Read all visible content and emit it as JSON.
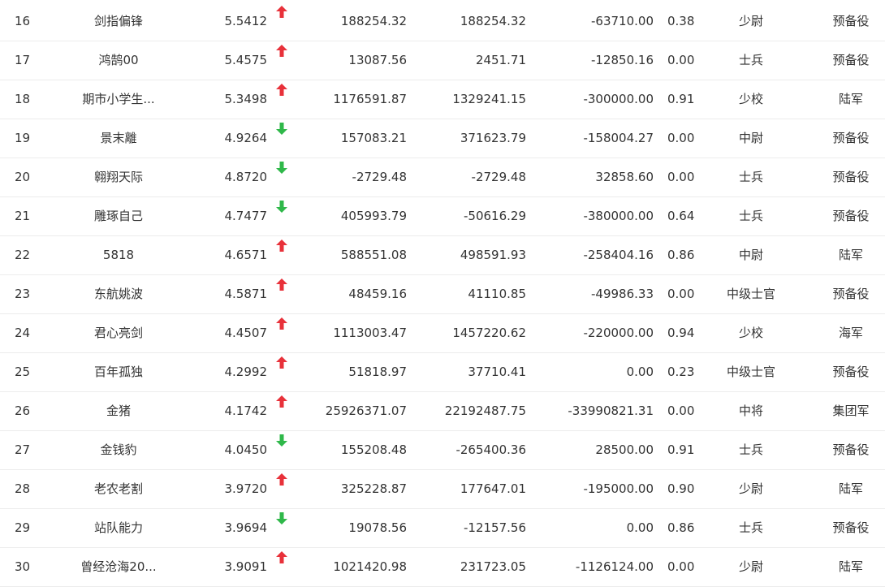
{
  "colors": {
    "up": "#e8313a",
    "down": "#2fb84a",
    "text": "#333333",
    "row_border": "#ececec"
  },
  "rows": [
    {
      "rank": "16",
      "name": "剑指偏锋",
      "score": "5.5412",
      "trend": "up",
      "v1": "188254.32",
      "v2": "188254.32",
      "v3": "-63710.00",
      "ratio": "0.38",
      "rank_title": "少尉",
      "group": "预备役"
    },
    {
      "rank": "17",
      "name": "鸿鹄00",
      "score": "5.4575",
      "trend": "up",
      "v1": "13087.56",
      "v2": "2451.71",
      "v3": "-12850.16",
      "ratio": "0.00",
      "rank_title": "士兵",
      "group": "预备役"
    },
    {
      "rank": "18",
      "name": "期市小学生...",
      "score": "5.3498",
      "trend": "up",
      "v1": "1176591.87",
      "v2": "1329241.15",
      "v3": "-300000.00",
      "ratio": "0.91",
      "rank_title": "少校",
      "group": "陆军"
    },
    {
      "rank": "19",
      "name": "景末離",
      "score": "4.9264",
      "trend": "down",
      "v1": "157083.21",
      "v2": "371623.79",
      "v3": "-158004.27",
      "ratio": "0.00",
      "rank_title": "中尉",
      "group": "预备役"
    },
    {
      "rank": "20",
      "name": "翱翔天际",
      "score": "4.8720",
      "trend": "down",
      "v1": "-2729.48",
      "v2": "-2729.48",
      "v3": "32858.60",
      "ratio": "0.00",
      "rank_title": "士兵",
      "group": "预备役"
    },
    {
      "rank": "21",
      "name": "雕琢自己",
      "score": "4.7477",
      "trend": "down",
      "v1": "405993.79",
      "v2": "-50616.29",
      "v3": "-380000.00",
      "ratio": "0.64",
      "rank_title": "士兵",
      "group": "预备役"
    },
    {
      "rank": "22",
      "name": "5818",
      "score": "4.6571",
      "trend": "up",
      "v1": "588551.08",
      "v2": "498591.93",
      "v3": "-258404.16",
      "ratio": "0.86",
      "rank_title": "中尉",
      "group": "陆军"
    },
    {
      "rank": "23",
      "name": "东航姚波",
      "score": "4.5871",
      "trend": "up",
      "v1": "48459.16",
      "v2": "41110.85",
      "v3": "-49986.33",
      "ratio": "0.00",
      "rank_title": "中级士官",
      "group": "预备役"
    },
    {
      "rank": "24",
      "name": "君心亮剑",
      "score": "4.4507",
      "trend": "up",
      "v1": "1113003.47",
      "v2": "1457220.62",
      "v3": "-220000.00",
      "ratio": "0.94",
      "rank_title": "少校",
      "group": "海军"
    },
    {
      "rank": "25",
      "name": "百年孤独",
      "score": "4.2992",
      "trend": "up",
      "v1": "51818.97",
      "v2": "37710.41",
      "v3": "0.00",
      "ratio": "0.23",
      "rank_title": "中级士官",
      "group": "预备役"
    },
    {
      "rank": "26",
      "name": "金猪",
      "score": "4.1742",
      "trend": "up",
      "v1": "25926371.07",
      "v2": "22192487.75",
      "v3": "-33990821.31",
      "ratio": "0.00",
      "rank_title": "中将",
      "group": "集团军"
    },
    {
      "rank": "27",
      "name": "金钱豹",
      "score": "4.0450",
      "trend": "down",
      "v1": "155208.48",
      "v2": "-265400.36",
      "v3": "28500.00",
      "ratio": "0.91",
      "rank_title": "士兵",
      "group": "预备役"
    },
    {
      "rank": "28",
      "name": "老农老割",
      "score": "3.9720",
      "trend": "up",
      "v1": "325228.87",
      "v2": "177647.01",
      "v3": "-195000.00",
      "ratio": "0.90",
      "rank_title": "少尉",
      "group": "陆军"
    },
    {
      "rank": "29",
      "name": "站队能力",
      "score": "3.9694",
      "trend": "down",
      "v1": "19078.56",
      "v2": "-12157.56",
      "v3": "0.00",
      "ratio": "0.86",
      "rank_title": "士兵",
      "group": "预备役"
    },
    {
      "rank": "30",
      "name": "曾经沧海20...",
      "score": "3.9091",
      "trend": "up",
      "v1": "1021420.98",
      "v2": "231723.05",
      "v3": "-1126124.00",
      "ratio": "0.00",
      "rank_title": "少尉",
      "group": "陆军"
    }
  ]
}
